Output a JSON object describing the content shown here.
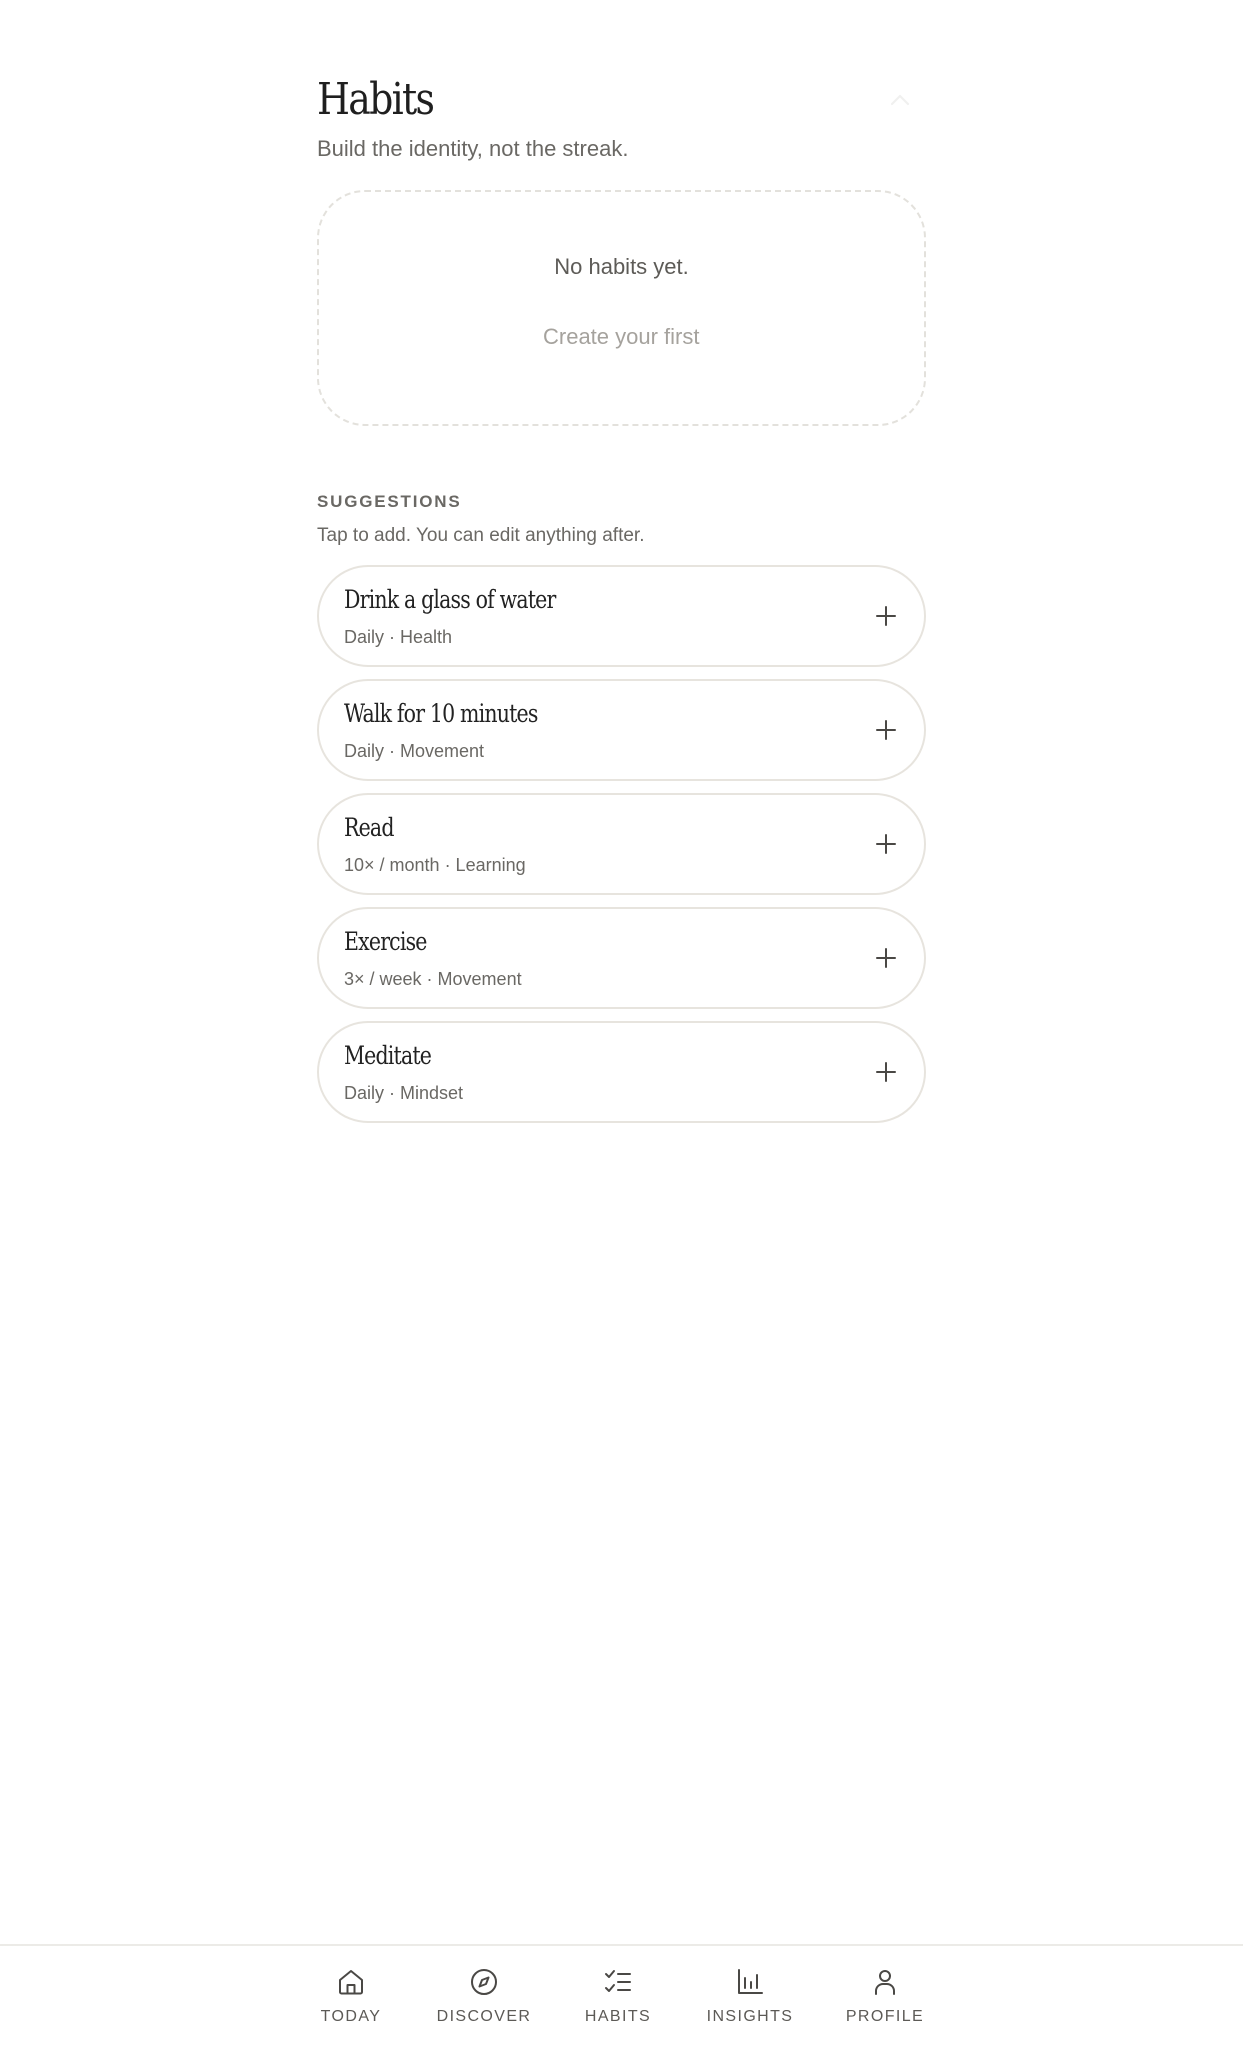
{
  "header": {
    "title": "Habits",
    "subtitle": "Build the identity, not the streak."
  },
  "empty_state": {
    "message": "No habits yet.",
    "cta_label": "Create your first"
  },
  "suggestions": {
    "section_label": "SUGGESTIONS",
    "help_text": "Tap to add. You can edit anything after.",
    "items": [
      {
        "title": "Drink a glass of water",
        "meta": "Daily · Health"
      },
      {
        "title": "Walk for 10 minutes",
        "meta": "Daily · Movement"
      },
      {
        "title": "Read",
        "meta": "10× / month · Learning"
      },
      {
        "title": "Exercise",
        "meta": "3× / week · Movement"
      },
      {
        "title": "Meditate",
        "meta": "Daily · Mindset"
      }
    ]
  },
  "nav": {
    "items": [
      {
        "label": "TODAY",
        "icon": "home-icon"
      },
      {
        "label": "DISCOVER",
        "icon": "compass-icon"
      },
      {
        "label": "HABITS",
        "icon": "checklist-icon",
        "active": true
      },
      {
        "label": "INSIGHTS",
        "icon": "bar-chart-icon"
      },
      {
        "label": "PROFILE",
        "icon": "person-icon"
      }
    ]
  },
  "colors": {
    "background": "#ffffff",
    "text_primary": "#1f1f1f",
    "text_secondary": "#6a6864",
    "text_muted": "#a5a29d",
    "border": "#e7e4de"
  }
}
